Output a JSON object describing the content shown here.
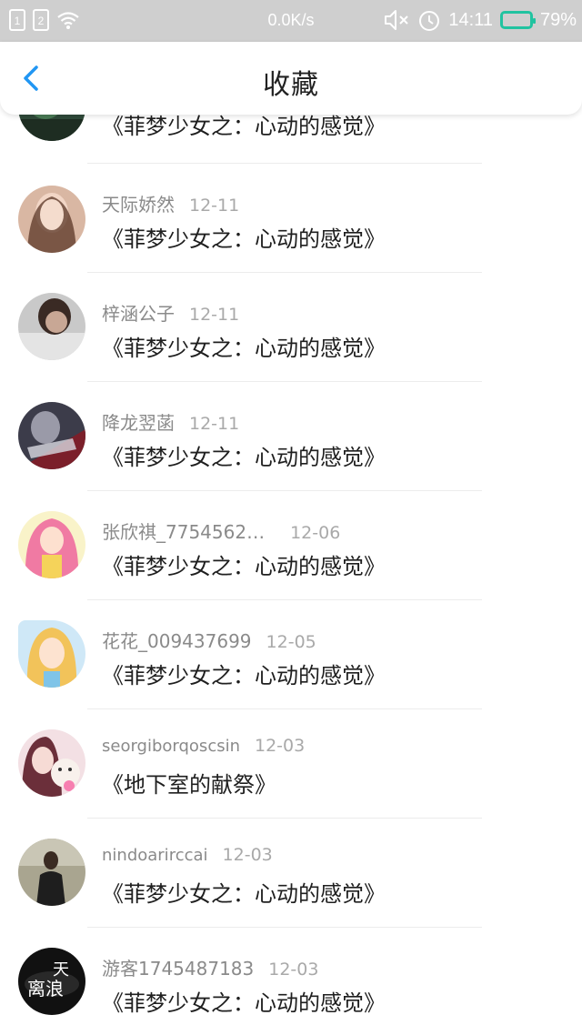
{
  "status_bar": {
    "sim1": "1",
    "sim2": "2",
    "net_speed": "0.0K/s",
    "time": "14:11",
    "battery": "79%"
  },
  "header": {
    "title": "收藏",
    "back_icon": "chevron-left-icon",
    "accent_color": "#2196F3"
  },
  "items": [
    {
      "name": "",
      "date": "",
      "book": "《菲梦少女之：心动的感觉》"
    },
    {
      "name": "天际娇然",
      "date": "12-11",
      "book": "《菲梦少女之：心动的感觉》"
    },
    {
      "name": "梓涵公子",
      "date": "12-11",
      "book": "《菲梦少女之：心动的感觉》"
    },
    {
      "name": "降龙翌菡",
      "date": "12-11",
      "book": "《菲梦少女之：心动的感觉》"
    },
    {
      "name": "张欣祺_7754562…",
      "date": "12-06",
      "book": "《菲梦少女之：心动的感觉》"
    },
    {
      "name": "花花_009437699",
      "date": "12-05",
      "book": "《菲梦少女之：心动的感觉》"
    },
    {
      "name": "seorgiborqoscsin",
      "date": "12-03",
      "book": "《地下室的献祭》"
    },
    {
      "name": "nindoarirccai",
      "date": "12-03",
      "book": "《菲梦少女之：心动的感觉》"
    },
    {
      "name": "游客1745487183",
      "date": "12-03",
      "book": "《菲梦少女之：心动的感觉》"
    }
  ],
  "avatar_badge_text": "天 离浪"
}
